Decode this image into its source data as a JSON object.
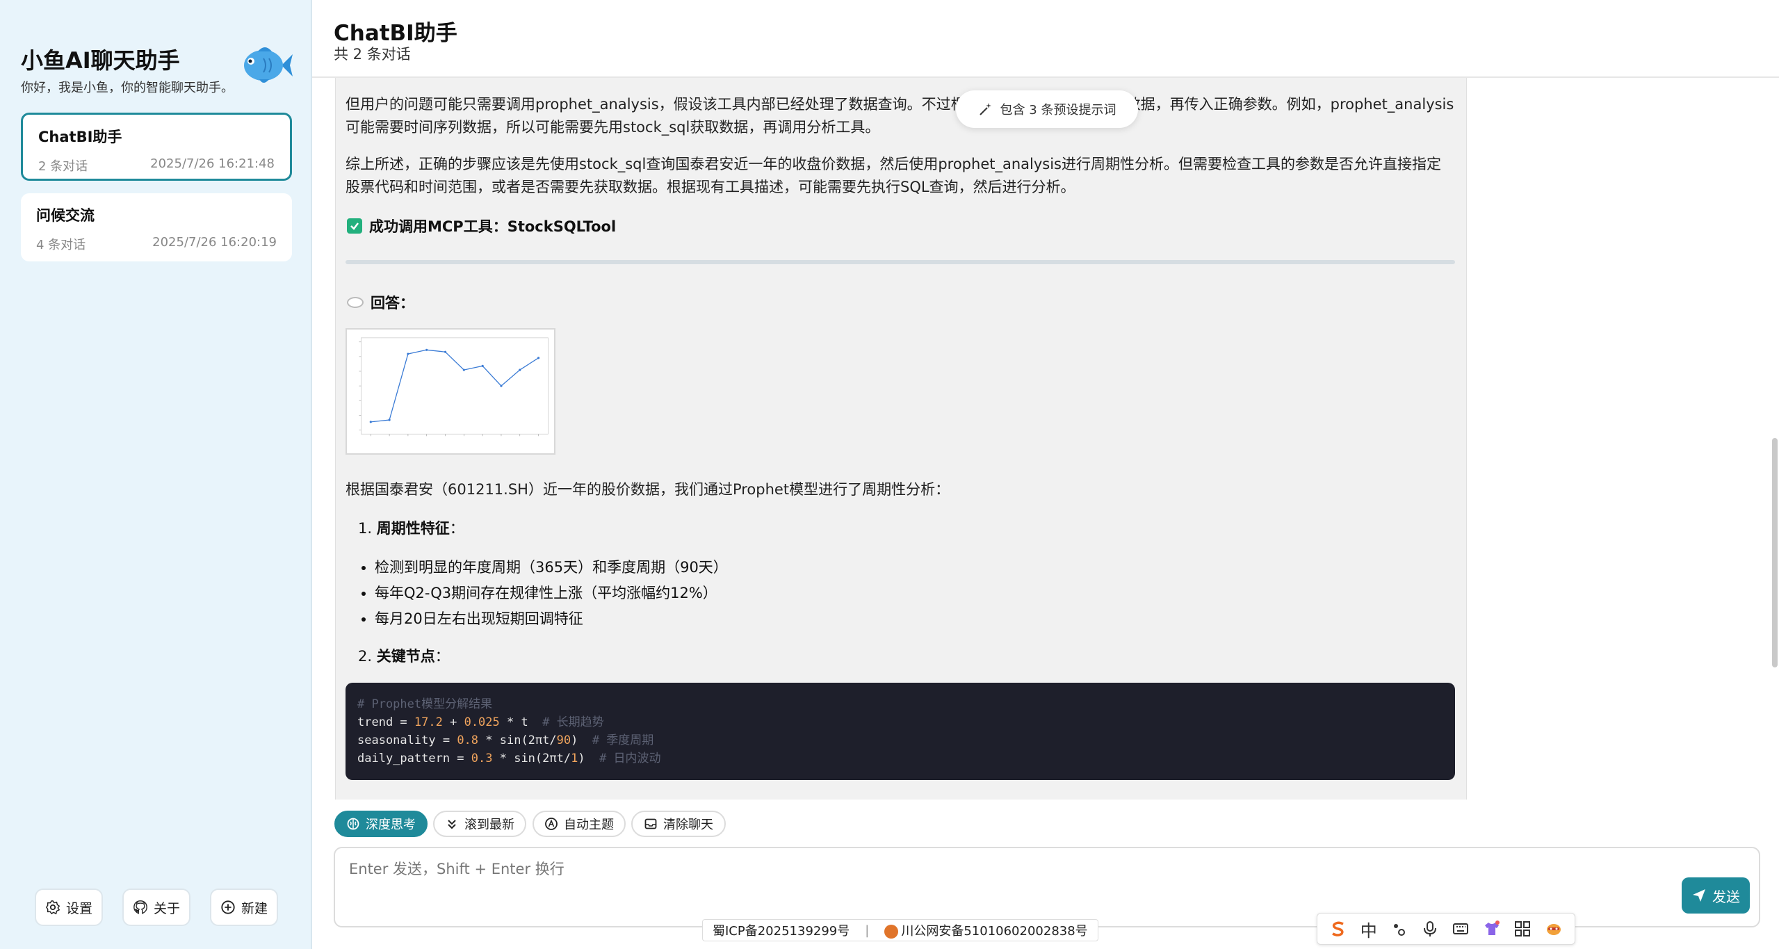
{
  "sidebar": {
    "brand_title": "小鱼AI聊天助手",
    "brand_subtitle": "你好，我是小鱼，你的智能聊天助手。",
    "conversations": [
      {
        "title": "ChatBI助手",
        "count": "2 条对话",
        "time": "2025/7/26 16:21:48",
        "active": true
      },
      {
        "title": "问候交流",
        "count": "4 条对话",
        "time": "2025/7/26 16:20:19",
        "active": false
      }
    ],
    "buttons": {
      "settings": "设置",
      "about": "关于",
      "new": "新建"
    }
  },
  "header": {
    "title": "ChatBI助手",
    "subtitle": "共 2 条对话"
  },
  "hint_pill": "包含 3 条预设提示词",
  "message": {
    "para1": "但用户的问题可能只需要调用prophet_analysis，假设该工具内部已经处理了数据查询。不过根据工具描述，需要先查询数据，再传入正确参数。例如，prophet_analysis可能需要时间序列数据，所以可能需要先用stock_sql获取数据，再调用分析工具。",
    "para2": "综上所述，正确的步骤应该是先使用stock_sql查询国泰君安近一年的收盘价数据，然后使用prophet_analysis进行周期性分析。但需要检查工具的参数是否允许直接指定股票代码和时间范围，或者是否需要先获取数据。根据现有工具描述，可能需要先执行SQL查询，然后进行分析。",
    "tool_success": "成功调用MCP工具：StockSQLTool",
    "answer_label": "回答：",
    "intro": "根据国泰君安（601211.SH）近一年的股价数据，我们通过Prophet模型进行了周期性分析：",
    "section1_num": "1.",
    "section1_title": "周期性特征",
    "section1_colon": "：",
    "bullets": [
      "检测到明显的年度周期（365天）和季度周期（90天）",
      "每年Q2-Q3期间存在规律性上涨（平均涨幅约12%）",
      "每月20日左右出现短期回调特征"
    ],
    "section2_num": "2.",
    "section2_title": "关键节点",
    "section2_colon": "：",
    "code": {
      "comment_header": "# Prophet模型分解结果",
      "line1": {
        "name": "trend",
        "eq": " = ",
        "n1": "17.2",
        "plus": " + ",
        "n2": "0.025",
        "rest": " * t  ",
        "comment": "# 长期趋势"
      },
      "line2": {
        "name": "seasonality",
        "eq": " = ",
        "n1": "0.8",
        "mid": " * sin(2πt/",
        "n2": "90",
        "close": ")  ",
        "comment": "# 季度周期"
      },
      "line3": {
        "name": "daily_pattern",
        "eq": " = ",
        "n1": "0.3",
        "mid": " * sin(2πt/",
        "n2": "1",
        "close": ")  ",
        "comment": "# 日内波动"
      }
    }
  },
  "chart_data": {
    "type": "line",
    "x": [
      0,
      1,
      2,
      3,
      4,
      5,
      6,
      7,
      8,
      9
    ],
    "values": [
      5,
      5.5,
      22,
      23,
      22.5,
      18,
      19,
      14,
      18,
      21
    ],
    "ylim": [
      3,
      25
    ],
    "color": "#3a7bd5"
  },
  "toolbar": {
    "deep_think": "深度思考",
    "scroll_latest": "滚到最新",
    "auto_theme": "自动主题",
    "clear_chat": "清除聊天"
  },
  "input": {
    "placeholder": "Enter 发送，Shift + Enter 换行",
    "value": ""
  },
  "send_label": "发送",
  "footer": {
    "icp": "蜀ICP备2025139299号",
    "separator": "|",
    "police": "川公网安备51010602002838号"
  },
  "ime": {
    "lang": "中"
  },
  "colors": {
    "accent": "#1f8a9a",
    "sidebar_bg": "#e8f4fb",
    "success": "#22b07d",
    "code_bg": "#1e1f2b"
  }
}
